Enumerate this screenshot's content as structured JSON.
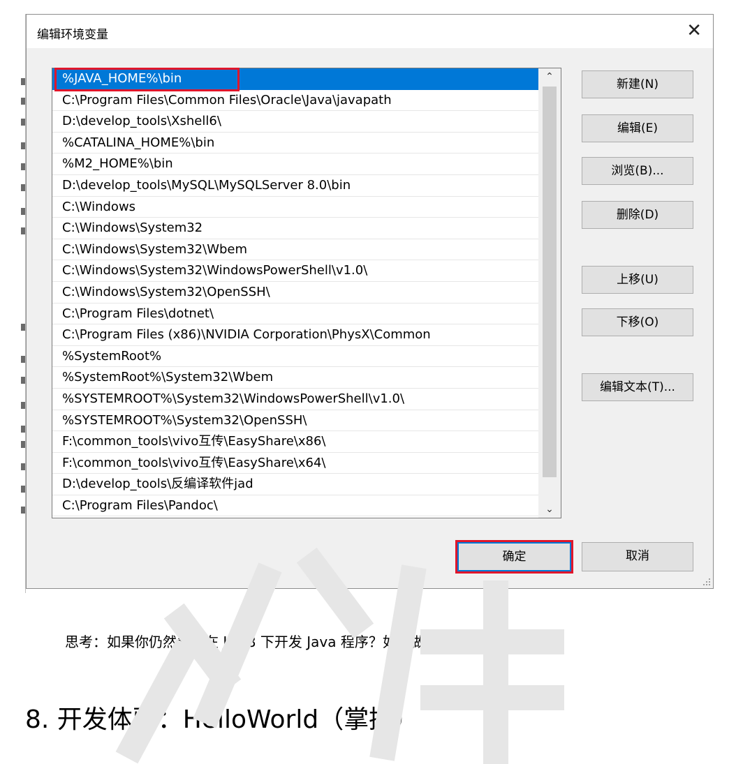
{
  "dialog": {
    "title": "编辑环境变量",
    "close_glyph": "✕",
    "path_entries": [
      "%JAVA_HOME%\\bin",
      "C:\\Program Files\\Common Files\\Oracle\\Java\\javapath",
      "D:\\develop_tools\\Xshell6\\",
      "%CATALINA_HOME%\\bin",
      "%M2_HOME%\\bin",
      "D:\\develop_tools\\MySQL\\MySQLServer 8.0\\bin",
      "C:\\Windows",
      "C:\\Windows\\System32",
      "C:\\Windows\\System32\\Wbem",
      "C:\\Windows\\System32\\WindowsPowerShell\\v1.0\\",
      "C:\\Windows\\System32\\OpenSSH\\",
      "C:\\Program Files\\dotnet\\",
      "C:\\Program Files (x86)\\NVIDIA Corporation\\PhysX\\Common",
      "%SystemRoot%",
      "%SystemRoot%\\System32\\Wbem",
      "%SYSTEMROOT%\\System32\\WindowsPowerShell\\v1.0\\",
      "%SYSTEMROOT%\\System32\\OpenSSH\\",
      "F:\\common_tools\\vivo互传\\EasyShare\\x86\\",
      "F:\\common_tools\\vivo互传\\EasyShare\\x64\\",
      "D:\\develop_tools\\反编译软件jad",
      "C:\\Program Files\\Pandoc\\"
    ],
    "selected_index": 0,
    "buttons": {
      "new": "新建(N)",
      "edit": "编辑(E)",
      "browse": "浏览(B)...",
      "delete": "删除(D)",
      "move_up": "上移(U)",
      "move_down": "下移(O)",
      "edit_text": "编辑文本(T)...",
      "ok": "确定",
      "cancel": "取消"
    },
    "scroll_up_glyph": "⌃",
    "scroll_down_glyph": "⌄"
  },
  "doc": {
    "think_text": "思考：如果你仍然希望在 JDK8 下开发 Java 程序？如何做呢？",
    "section_heading": "8. 开发体验：HelloWorld（掌握）"
  },
  "colors": {
    "selection": "#0078d7",
    "highlight_red": "#e0162b",
    "dialog_bg": "#f0f0f0"
  }
}
